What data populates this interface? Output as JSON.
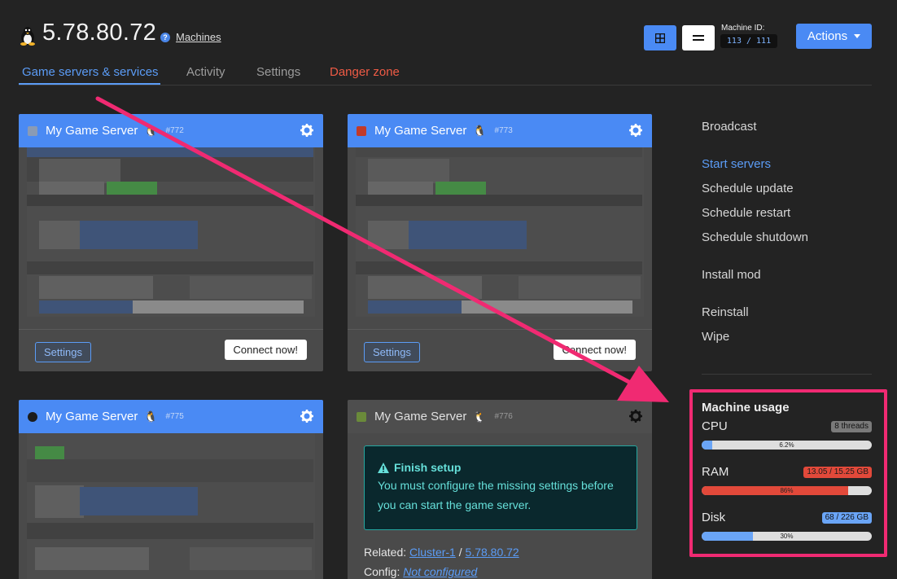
{
  "header": {
    "title": "5.78.80.72",
    "machines_link": "Machines",
    "machine_id_label": "Machine ID:",
    "machine_id_value": "113 / 111",
    "actions_label": "Actions"
  },
  "tabs": [
    {
      "label": "Game servers & services"
    },
    {
      "label": "Activity"
    },
    {
      "label": "Settings"
    },
    {
      "label": "Danger zone"
    }
  ],
  "servers": [
    {
      "name": "My Game Server",
      "number": "#772",
      "icon": "game-icon",
      "settings_label": "Settings",
      "connect_label": "Connect now!"
    },
    {
      "name": "My Game Server",
      "number": "#773",
      "icon": "game-icon",
      "settings_label": "Settings",
      "connect_label": "Connect now!"
    },
    {
      "name": "My Game Server",
      "number": "#775",
      "icon": "game-icon"
    },
    {
      "name": "My Game Server",
      "number": "#776",
      "icon": "game-icon",
      "setup_title": "Finish setup",
      "setup_text": "You must configure the missing settings before you can start the game server.",
      "related_label": "Related:",
      "related_link1": "Cluster-1",
      "related_sep": "/",
      "related_link2": "5.78.80.72",
      "config_label": "Config:",
      "config_value": "Not configured"
    }
  ],
  "sidebar": {
    "broadcast": "Broadcast",
    "start_servers": "Start servers",
    "schedule_update": "Schedule update",
    "schedule_restart": "Schedule restart",
    "schedule_shutdown": "Schedule shutdown",
    "install_mod": "Install mod",
    "reinstall": "Reinstall",
    "wipe": "Wipe"
  },
  "usage": {
    "title": "Machine usage",
    "cpu": {
      "label": "CPU",
      "badge": "8 threads",
      "percent": 6.2,
      "percent_text": "6.2%"
    },
    "ram": {
      "label": "RAM",
      "badge": "13.05 / 15.25 GB",
      "percent": 86,
      "percent_text": "86%"
    },
    "disk": {
      "label": "Disk",
      "badge": "68 / 226 GB",
      "percent": 30,
      "percent_text": "30%"
    }
  },
  "colors": {
    "accent": "#4a8af4",
    "danger": "#ef5b45",
    "highlight": "#f02a72",
    "cpu_bar": "#6aa5f7",
    "ram_bar": "#e2493a",
    "disk_bar": "#6aa5f7"
  }
}
